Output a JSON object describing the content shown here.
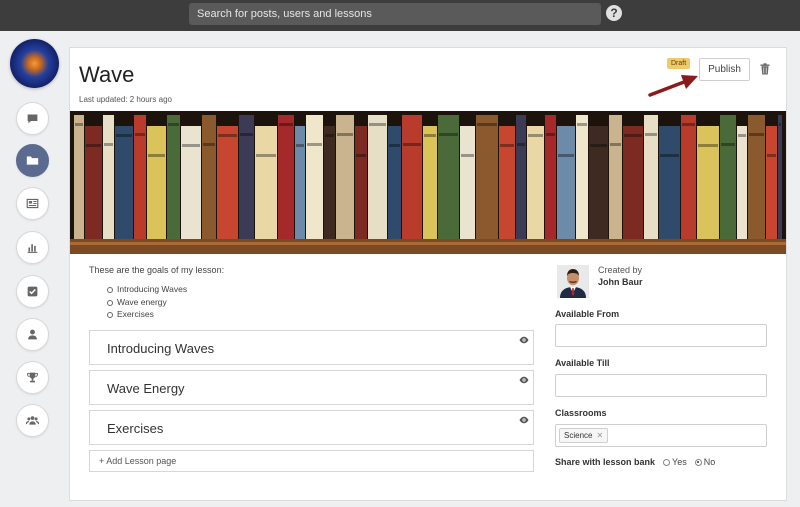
{
  "topbar": {
    "search_placeholder": "Search for posts, users and lessons",
    "help_glyph": "?"
  },
  "rail": {
    "items": [
      {
        "name": "comments",
        "icon": "chat-bubble-icon",
        "active": false
      },
      {
        "name": "folders",
        "icon": "folder-icon",
        "active": true
      },
      {
        "name": "news",
        "icon": "newspaper-icon",
        "active": false
      },
      {
        "name": "stats",
        "icon": "bar-chart-icon",
        "active": false
      },
      {
        "name": "tasks",
        "icon": "checkbox-icon",
        "active": false
      },
      {
        "name": "profile",
        "icon": "user-icon",
        "active": false
      },
      {
        "name": "awards",
        "icon": "trophy-icon",
        "active": false
      },
      {
        "name": "groups",
        "icon": "group-icon",
        "active": false
      }
    ]
  },
  "lesson": {
    "title": "Wave",
    "last_updated": "Last updated: 2 hours ago",
    "status_badge": "Draft",
    "publish_label": "Publish",
    "goals_intro": "These are the goals of my lesson:",
    "goals": [
      "Introducing Waves",
      "Wave energy",
      "Exercises"
    ],
    "pages": [
      {
        "label": "Introducing Waves"
      },
      {
        "label": "Wave Energy"
      },
      {
        "label": "Exercises"
      }
    ],
    "add_page_label": "+ Add Lesson page"
  },
  "sidebar": {
    "created_by_label": "Created by",
    "author_name": "John Baur",
    "available_from_label": "Available From",
    "available_from_value": "",
    "available_till_label": "Available Till",
    "available_till_value": "",
    "classrooms_label": "Classrooms",
    "classroom_chip": "Science",
    "share_label": "Share with lesson bank",
    "share_yes": "Yes",
    "share_no": "No",
    "share_selected": "No"
  },
  "colors": {
    "accent": "#5b6b8f",
    "draft_badge": "#f0c96a",
    "annotation_arrow": "#8b1a1a",
    "topbar": "#3d3d3d"
  }
}
